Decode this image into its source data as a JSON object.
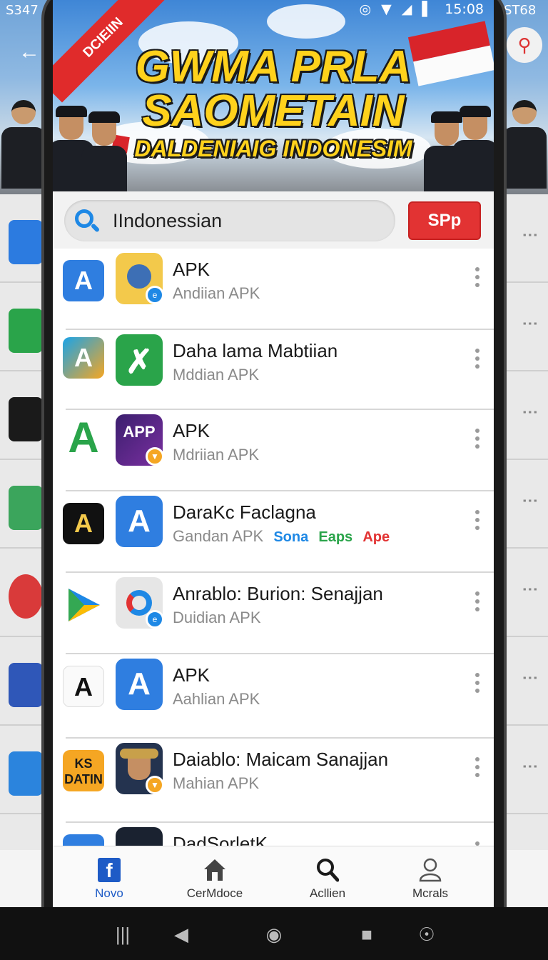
{
  "background_app": {
    "status_left": "S347",
    "status_right": "ST68"
  },
  "status_bar": {
    "time": "15:08",
    "icons": "◎ ▼ ◢ ▌"
  },
  "banner": {
    "ribbon": "DCIEIIN",
    "title_line1": "GWMA PRLA",
    "title_line2": "SAOMETAIN",
    "title_line3": "DALDENIAIG INDONESIM"
  },
  "search": {
    "value": "IIndonessian",
    "button_label": "SPp"
  },
  "list": [
    {
      "title": "APK",
      "subtitle": "Andiian APK"
    },
    {
      "title": "Daha lama Mabtiian",
      "subtitle": "Mddian APK"
    },
    {
      "title": "APK",
      "subtitle": "Mdriian APK",
      "icon_text": "APP"
    },
    {
      "title": "DaraKc Faclagna",
      "subtitle": "Gandan  APK",
      "tags": [
        "Sona",
        "Eaps",
        "Ape"
      ]
    },
    {
      "title": "Anrablo: Burion: Senajjan",
      "subtitle": "Duidian APK"
    },
    {
      "title": "APK",
      "subtitle": "Aahlian APK"
    },
    {
      "title": "Daiablo: Maicam Sanajjan",
      "subtitle": "Mahian APK"
    },
    {
      "title": "DadSorletK",
      "subtitle": ""
    }
  ],
  "bottom_nav": [
    {
      "label": "Novo"
    },
    {
      "label": "CerMdoce"
    },
    {
      "label": "Acllien"
    },
    {
      "label": "Mcrals"
    }
  ],
  "colors": {
    "accent_red": "#e23333",
    "accent_blue": "#1e88e5",
    "banner_yellow": "#ffd21c"
  }
}
